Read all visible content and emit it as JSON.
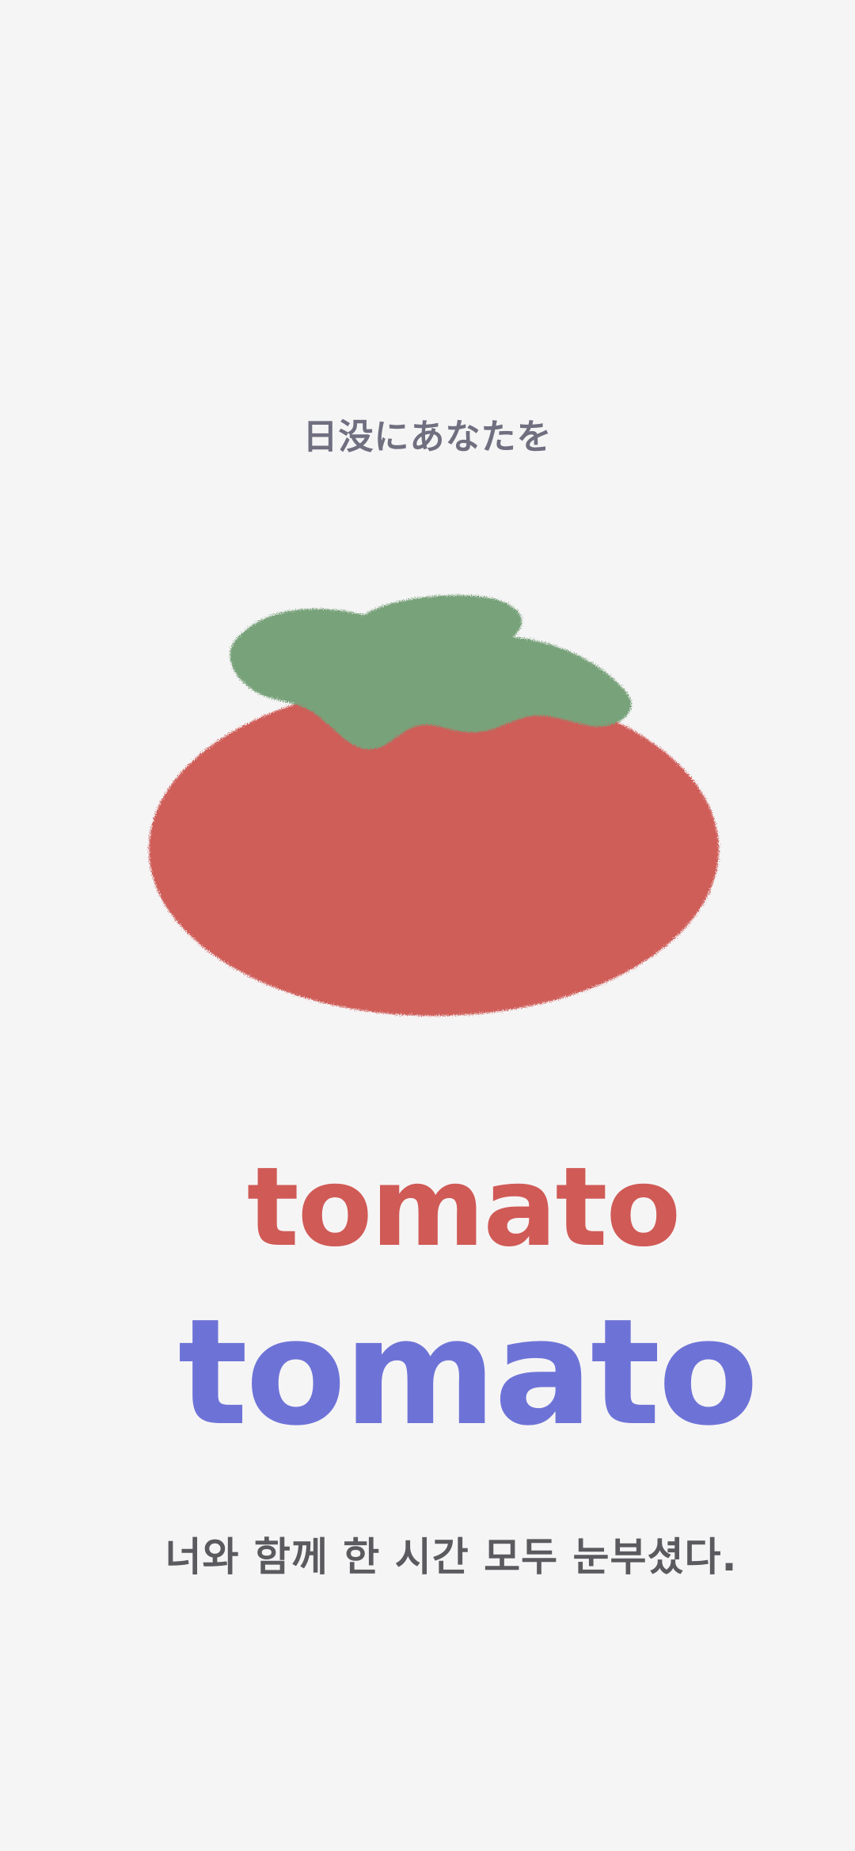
{
  "top_caption": "日没にあなたを",
  "word_primary": "tomato",
  "word_secondary": "tomato",
  "bottom_caption": "너와 함께 한 시간 모두 눈부셨다.",
  "illustration": {
    "subject": "tomato-icon",
    "body_color": "#cf5d59",
    "leaf_color": "#78a27a"
  },
  "colors": {
    "background": "#f6f5f6",
    "red_word": "#d05a56",
    "blue_word": "#6d73d6",
    "caption": "#6f6f80",
    "bottom_caption": "#5b5b5f"
  }
}
